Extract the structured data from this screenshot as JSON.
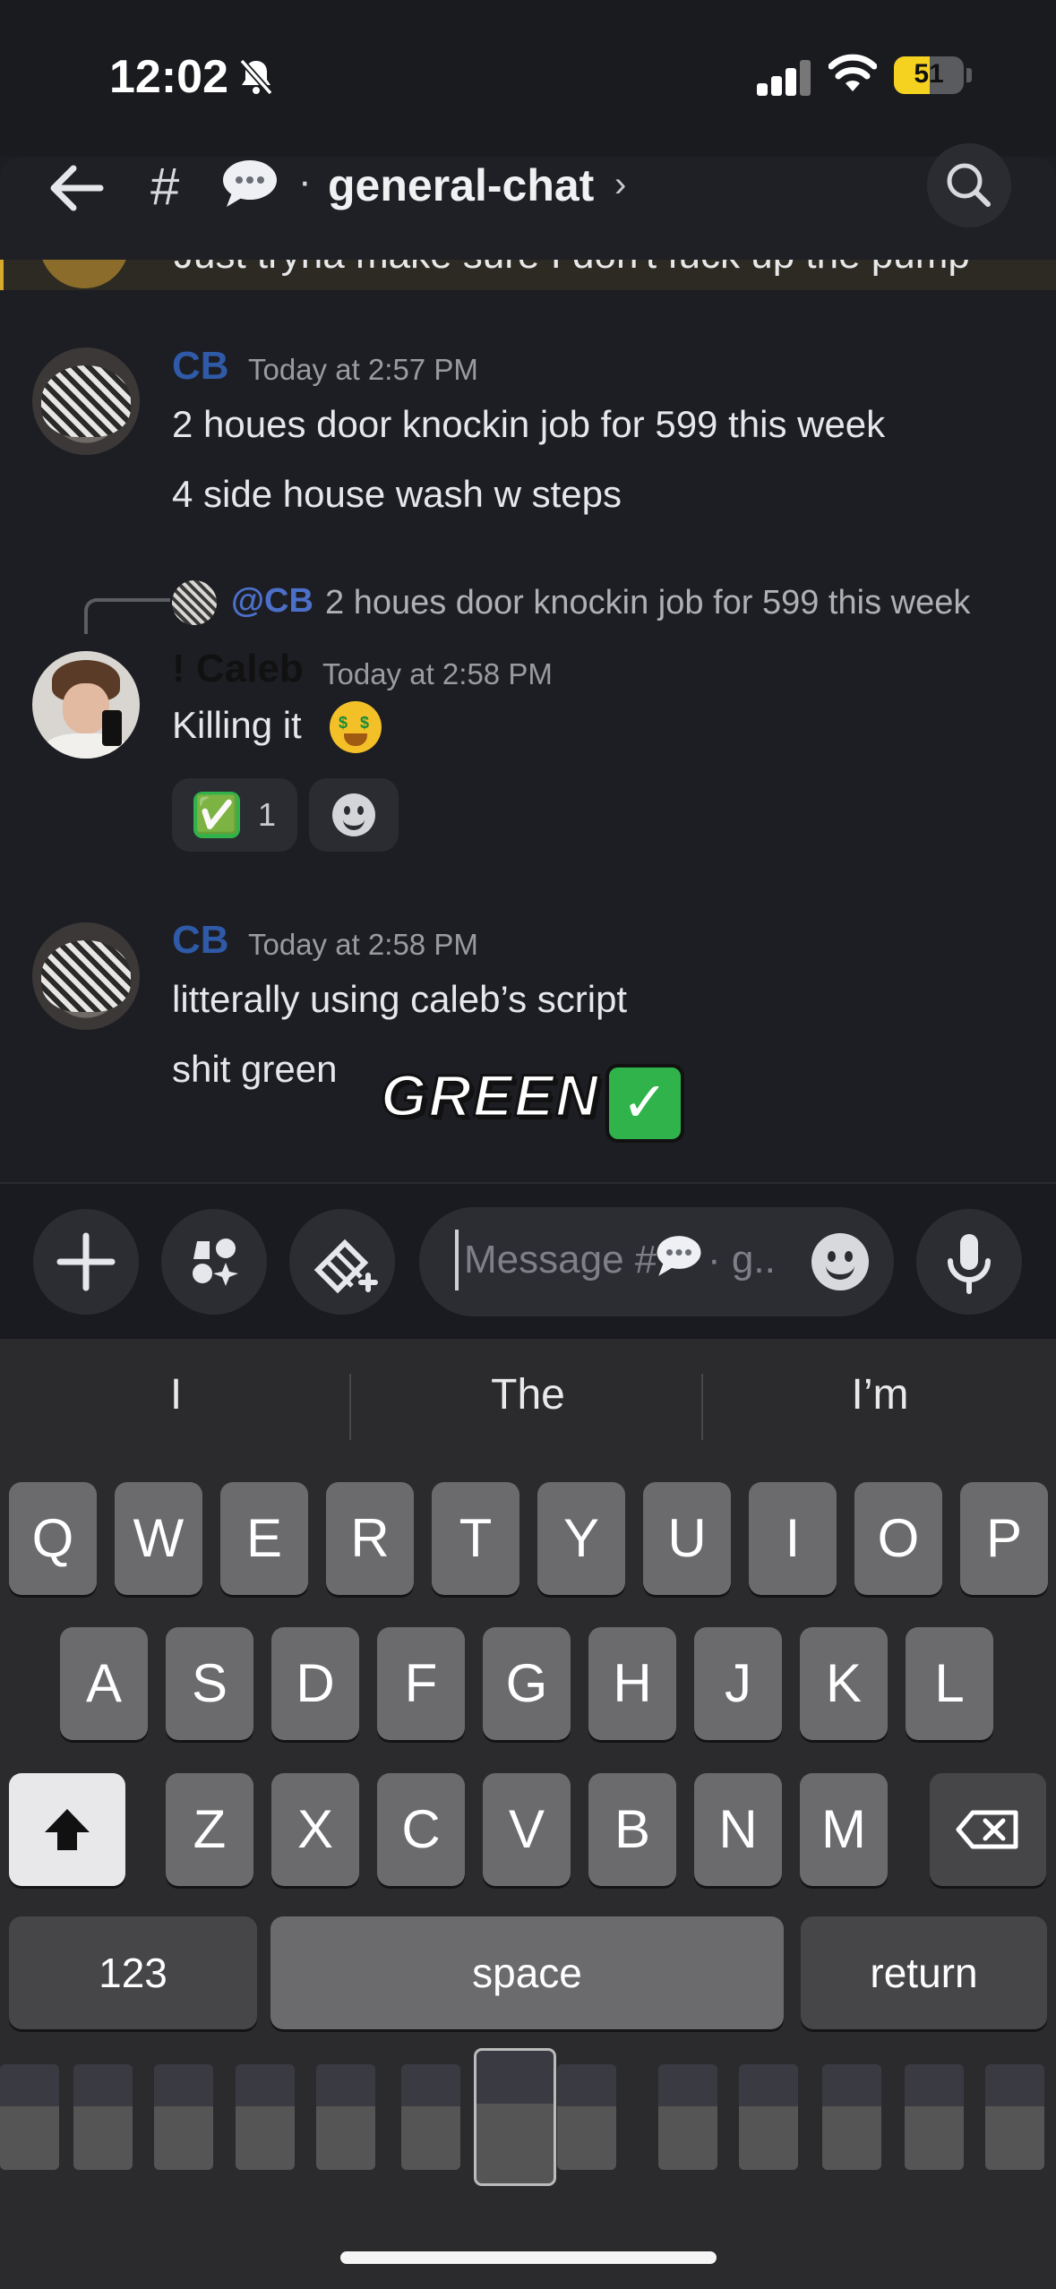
{
  "status_bar": {
    "time": "12:02",
    "battery": "51",
    "battery_level": 0.51,
    "icons": [
      "bell-slash-icon",
      "cellular-signal-icon",
      "wifi-icon",
      "battery-icon"
    ]
  },
  "header": {
    "hash": "#",
    "channel_emoji": "speech-bubble-icon",
    "dot": "·",
    "channel_name": "general-chat",
    "chevron": "›",
    "search_icon": "search-icon"
  },
  "previous_message": {
    "text": "Just tryna make sure I don't fuck up the pump"
  },
  "messages": [
    {
      "username": "CB",
      "username_color": "#2f5aa8",
      "timestamp": "Today at 2:57 PM",
      "lines": [
        "2 houes door knockin job for 599 this week",
        "4 side house wash w steps"
      ]
    },
    {
      "reply": {
        "mention": "@CB",
        "text": "2 houes door knockin job for 599 this week"
      },
      "username": "! Caleb",
      "username_color": "#111111",
      "timestamp": "Today at 2:58 PM",
      "lines": [
        "Killing it"
      ],
      "reactions": [
        {
          "emoji": "✅",
          "count": "1"
        },
        {
          "emoji": "add-reaction-icon"
        }
      ]
    },
    {
      "username": "CB",
      "username_color": "#2f5aa8",
      "timestamp": "Today at 2:58 PM",
      "lines": [
        "litterally using caleb’s script",
        "shit green"
      ],
      "sticker": {
        "text": "GREEN",
        "check": "✓"
      }
    }
  ],
  "composer": {
    "placeholder_prefix": "Message #",
    "placeholder_suffix": "· g..",
    "buttons": [
      "plus-icon",
      "apps-icon",
      "gift-icon",
      "emoji-icon",
      "microphone-icon"
    ]
  },
  "keyboard": {
    "suggestions": [
      "I",
      "The",
      "I’m"
    ],
    "row1": [
      "Q",
      "W",
      "E",
      "R",
      "T",
      "Y",
      "U",
      "I",
      "O",
      "P"
    ],
    "row2": [
      "A",
      "S",
      "D",
      "F",
      "G",
      "H",
      "J",
      "K",
      "L"
    ],
    "row3": [
      "Z",
      "X",
      "C",
      "V",
      "B",
      "N",
      "M"
    ],
    "numbers_key": "123",
    "space_key": "space",
    "return_key": "return",
    "shift_icon": "shift-icon",
    "delete_icon": "delete-icon"
  },
  "colors": {
    "background": "#1d1e23",
    "accent_green": "#2fb34a",
    "mention_blue": "#4c6fc9"
  }
}
